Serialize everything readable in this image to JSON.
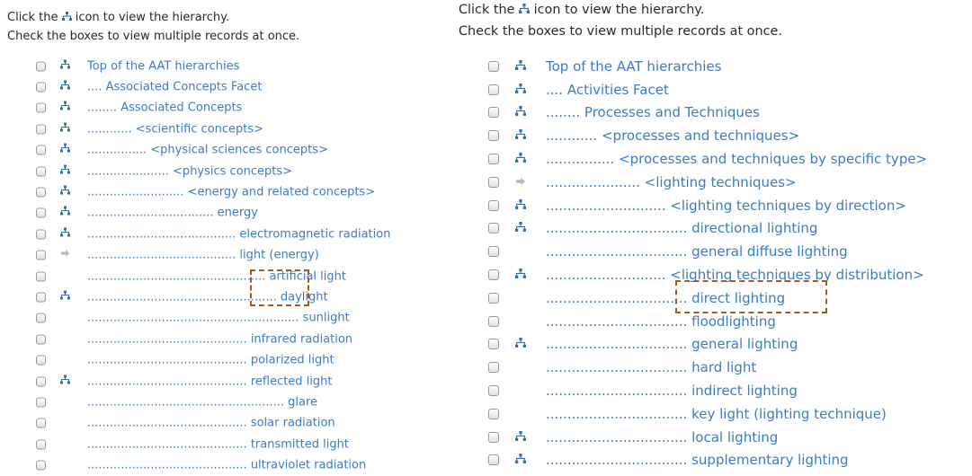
{
  "colors": {
    "link": "#3d7bc4",
    "hierarchy_icon": "#2f6db5",
    "arrow_icon": "#b8b8b8",
    "highlight": "#a65a1e"
  },
  "icons": {
    "hierarchy": "hierarchy-tree-icon",
    "leaf": "arrow-right-icon"
  },
  "left_panel": {
    "instructions": {
      "line1_before": "Click the ",
      "line1_after": " icon to view the hierarchy.",
      "line2": "Check the boxes to view multiple records at once."
    },
    "rows": [
      {
        "term": "Top of the AAT hierarchies",
        "icon": "hierarchy"
      },
      {
        "term": ".... Associated Concepts Facet",
        "icon": "hierarchy"
      },
      {
        "term": "........ Associated Concepts",
        "icon": "hierarchy"
      },
      {
        "term": "............ <scientific concepts>",
        "icon": "hierarchy"
      },
      {
        "term": "................ <physical sciences concepts>",
        "icon": "hierarchy"
      },
      {
        "term": "...................... <physics concepts>",
        "icon": "hierarchy"
      },
      {
        "term": ".......................... <energy and related concepts>",
        "icon": "hierarchy"
      },
      {
        "term": ".................................. energy",
        "icon": "hierarchy"
      },
      {
        "term": "........................................ electromagnetic radiation",
        "icon": "hierarchy"
      },
      {
        "term": "........................................ light (energy)",
        "icon": "leaf"
      },
      {
        "term": "................................................ artificial light",
        "icon": "none"
      },
      {
        "term": "................................................... daylight",
        "icon": "hierarchy"
      },
      {
        "term": "......................................................... sunlight",
        "icon": "none"
      },
      {
        "term": "........................................... infrared radiation",
        "icon": "none"
      },
      {
        "term": "........................................... polarized light",
        "icon": "none"
      },
      {
        "term": "........................................... reflected light",
        "icon": "hierarchy"
      },
      {
        "term": "..................................................... glare",
        "icon": "none"
      },
      {
        "term": "........................................... solar radiation",
        "icon": "none"
      },
      {
        "term": "........................................... transmitted light",
        "icon": "none"
      },
      {
        "term": "........................................... ultraviolet radiation",
        "icon": "none"
      }
    ]
  },
  "right_panel": {
    "instructions": {
      "line1_before": "Click the ",
      "line1_after": " icon to view the hierarchy.",
      "line2": "Check the boxes to view multiple records at once."
    },
    "rows": [
      {
        "term": "Top of the AAT hierarchies",
        "icon": "hierarchy"
      },
      {
        "term": ".... Activities Facet",
        "icon": "hierarchy"
      },
      {
        "term": "........ Processes and Techniques",
        "icon": "hierarchy"
      },
      {
        "term": "............ <processes and techniques>",
        "icon": "hierarchy"
      },
      {
        "term": "................ <processes and techniques by specific type>",
        "icon": "hierarchy"
      },
      {
        "term": "...................... <lighting techniques>",
        "icon": "leaf"
      },
      {
        "term": "............................ <lighting techniques by direction>",
        "icon": "hierarchy"
      },
      {
        "term": "................................. directional lighting",
        "icon": "hierarchy"
      },
      {
        "term": "................................. general diffuse lighting",
        "icon": "none"
      },
      {
        "term": "............................ <lighting techniques by distribution>",
        "icon": "hierarchy"
      },
      {
        "term": "................................. direct lighting",
        "icon": "none"
      },
      {
        "term": "................................. floodlighting",
        "icon": "none"
      },
      {
        "term": "................................. general lighting",
        "icon": "hierarchy"
      },
      {
        "term": "................................. hard light",
        "icon": "none"
      },
      {
        "term": "................................. indirect lighting",
        "icon": "none"
      },
      {
        "term": "................................. key light (lighting technique)",
        "icon": "none"
      },
      {
        "term": "................................. local lighting",
        "icon": "hierarchy"
      },
      {
        "term": "................................. supplementary lighting",
        "icon": "hierarchy"
      }
    ]
  }
}
